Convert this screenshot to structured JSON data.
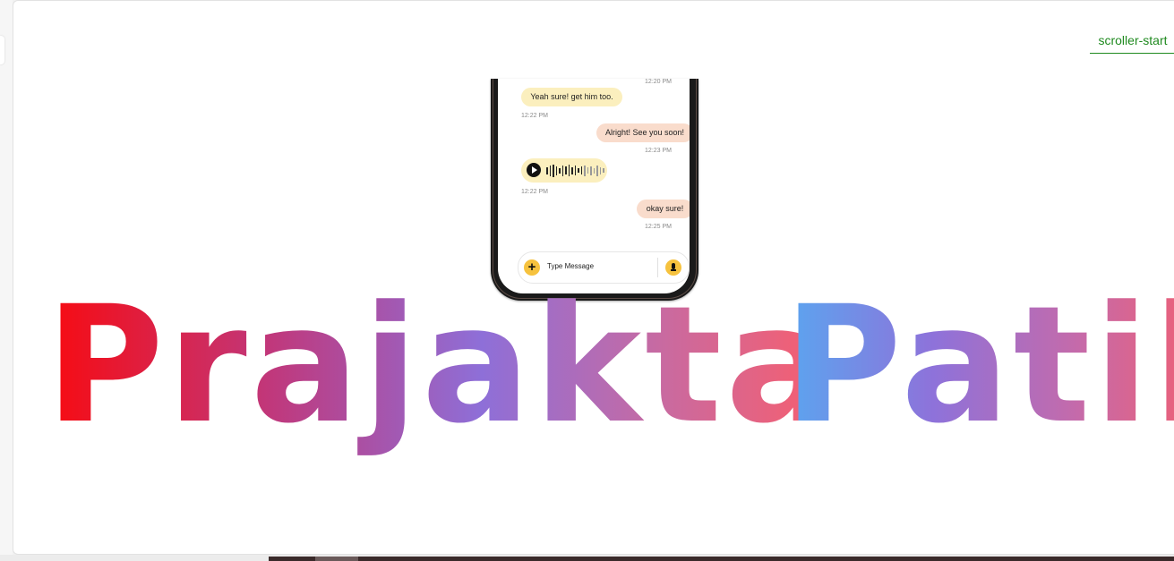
{
  "scroller": {
    "label": "scroller-start",
    "color": "#1f8a1f"
  },
  "chat": {
    "top_timestamp": "12:20 PM",
    "messages": [
      {
        "type": "text",
        "direction": "in",
        "text": "Yeah sure! get him too.",
        "time": "12:22 PM"
      },
      {
        "type": "text",
        "direction": "out",
        "text": "Alright! See you soon!",
        "time": "12:23 PM"
      },
      {
        "type": "voice",
        "direction": "in",
        "icon": "play-icon",
        "time": "12:22 PM"
      },
      {
        "type": "text",
        "direction": "out",
        "text": "okay sure!",
        "time": "12:25 PM"
      }
    ],
    "composer": {
      "placeholder": "Type Message",
      "attach_icon": "plus-icon",
      "mic_icon": "microphone-icon",
      "accent": "#f6c23e"
    },
    "bubble_colors": {
      "incoming": "#fbefbe",
      "outgoing": "#f9dccc"
    }
  },
  "hero": {
    "first_name": "Prajakta",
    "last_name": "Patil",
    "gradient_colors": [
      "#f80a10",
      "#8e6fd8",
      "#fb5d6a",
      "#5aa6f0"
    ]
  }
}
